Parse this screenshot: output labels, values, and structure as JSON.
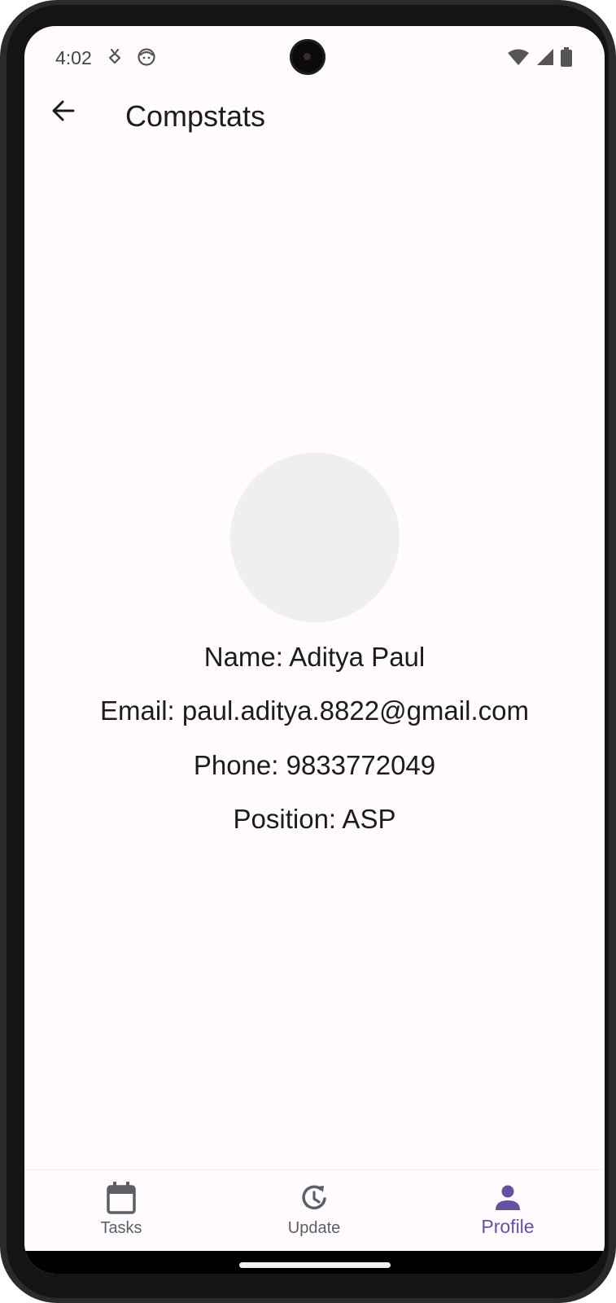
{
  "status_bar": {
    "time": "4:02"
  },
  "app_bar": {
    "title": "Compstats"
  },
  "profile": {
    "name_line": "Name: Aditya Paul",
    "email_line": "Email: paul.aditya.8822@gmail.com",
    "phone_line": "Phone: 9833772049",
    "position_line": "Position: ASP"
  },
  "bottom_nav": {
    "items": [
      {
        "label": "Tasks",
        "icon": "calendar-icon"
      },
      {
        "label": "Update",
        "icon": "history-update-icon"
      },
      {
        "label": "Profile",
        "icon": "person-icon",
        "active": true
      }
    ]
  },
  "colors": {
    "accent": "#6750a4",
    "background": "#fffbfe",
    "avatar": "#eeefee"
  }
}
